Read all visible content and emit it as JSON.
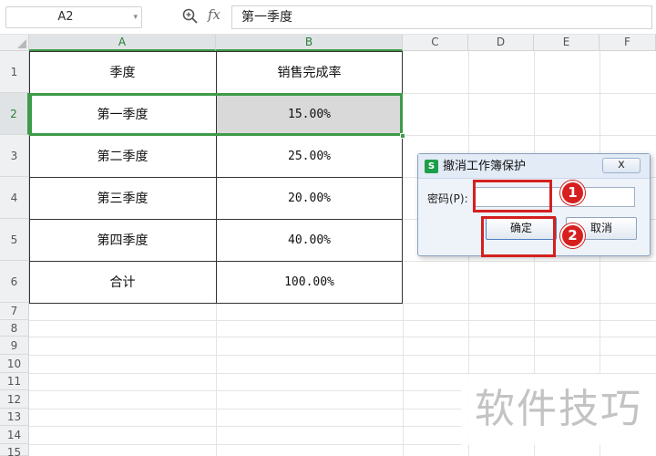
{
  "formula_bar": {
    "cell_ref": "A2",
    "function_label": "fx",
    "formula_value": "第一季度"
  },
  "columns": [
    "A",
    "B",
    "C",
    "D",
    "E",
    "F"
  ],
  "rows": [
    "1",
    "2",
    "3",
    "4",
    "5",
    "6",
    "7",
    "8",
    "9",
    "10",
    "11",
    "12",
    "13",
    "14",
    "15"
  ],
  "table": {
    "header": [
      "季度",
      "销售完成率"
    ],
    "rows": [
      [
        "第一季度",
        "15.00%"
      ],
      [
        "第二季度",
        "25.00%"
      ],
      [
        "第三季度",
        "20.00%"
      ],
      [
        "第四季度",
        "40.00%"
      ],
      [
        "合计",
        "100.00%"
      ]
    ]
  },
  "dialog": {
    "title": "撤消工作簿保护",
    "app_icon": "S",
    "close_label": "x",
    "password_label": "密码(P):",
    "password_value": "",
    "ok_label": "确定",
    "cancel_label": "取消"
  },
  "callouts": [
    "1",
    "2"
  ],
  "watermark": "软件技巧",
  "colors": {
    "selection_green": "#3d9b49",
    "callout_red": "#d71f1f",
    "header_bg": "#eef0f2",
    "selected_cell_bg": "#d9d9d9"
  },
  "icons": {
    "zoom": "zoom-icon",
    "dropdown": "chevron-down-icon",
    "close": "close-icon",
    "app": "wps-spreadsheet-icon"
  }
}
